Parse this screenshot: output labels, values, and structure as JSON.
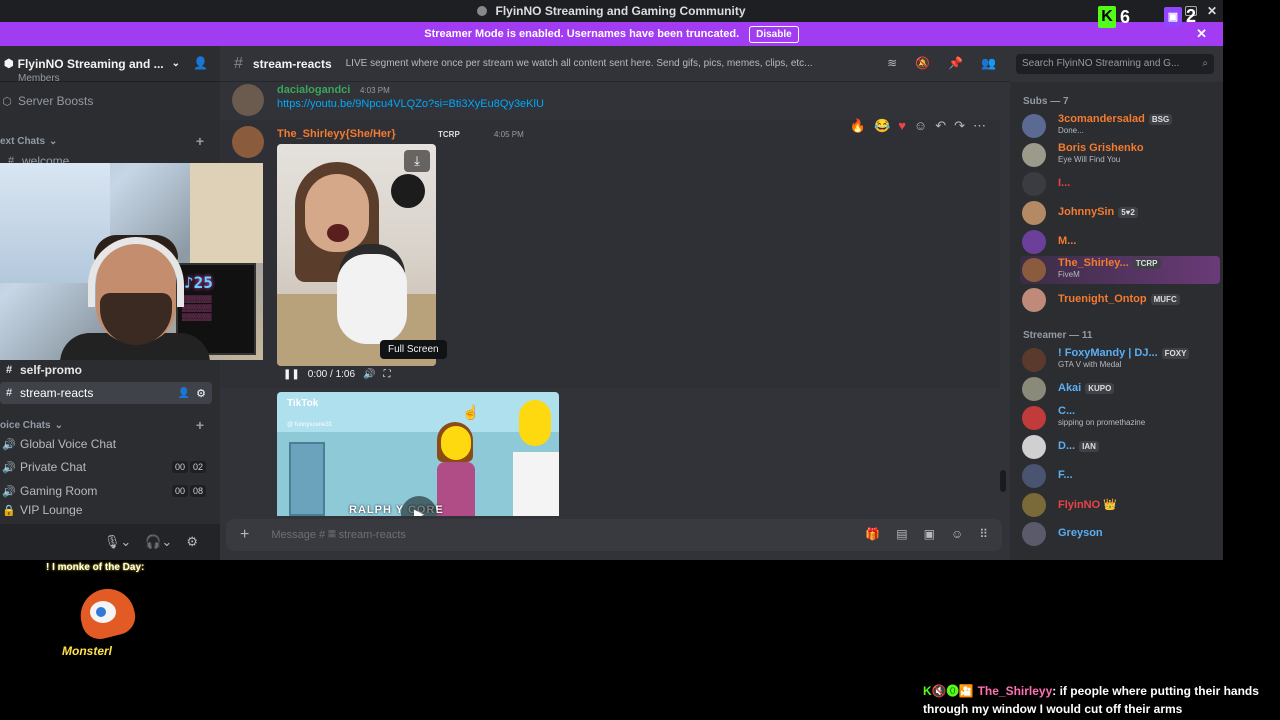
{
  "window": {
    "title": "FlyinNO Streaming and Gaming Community"
  },
  "banner": {
    "text": "Streamer Mode is enabled. Usernames have been truncated.",
    "button": "Disable",
    "close": "✕"
  },
  "overlay": {
    "kick_count": "6",
    "twitch_count": "2",
    "kick_icon": "K",
    "twitch_icon": "▣"
  },
  "server": {
    "name": "FlyinNO Streaming and ...",
    "members_label": "Members"
  },
  "sidebar": {
    "boosts": "Server Boosts",
    "text_cat": "ext Chats",
    "welcome": "welcome",
    "self_promo": "self-promo",
    "stream_reacts": "stream-reacts",
    "voice_cat": "oice Chats",
    "voice": [
      {
        "name": "Global Voice Chat"
      },
      {
        "name": "Private Chat",
        "a": "00",
        "b": "02"
      },
      {
        "name": "Gaming Room",
        "a": "00",
        "b": "08"
      },
      {
        "name": "VIP Lounge"
      }
    ]
  },
  "channel": {
    "name": "stream-reacts",
    "topic": "LIVE segment where once per stream we watch all content sent here. Send gifs, pics, memes, clips, etc..."
  },
  "search": {
    "placeholder": "Search FlyinNO Streaming and G..."
  },
  "messages": [
    {
      "author": "dacialogandci",
      "time": "4:03 PM",
      "link": "https://youtu.be/9Npcu4VLQZo?si=Bti3XyEu8Qy3eKlU"
    },
    {
      "author": "The_Shirleyy{She/Her}",
      "tag": "TCRP",
      "time": "4:05 PM"
    }
  ],
  "video1": {
    "time": "0:00 / 1:06",
    "tooltip": "Full Screen"
  },
  "video2": {
    "brand": "TikTok",
    "handle": "@ funnyscene31",
    "caption": "RALPH  Y CORE"
  },
  "composer": {
    "placeholder": "Message # 𝄜 stream-reacts"
  },
  "members": {
    "subs_header": "Subs — 7",
    "subs": [
      {
        "name": "3comandersalad",
        "tag": "BSG",
        "sub": "Done...",
        "color": "#f47b2f"
      },
      {
        "name": "Boris Grishenko",
        "sub": "Eye Will Find You",
        "color": "#f47b2f"
      },
      {
        "name": "I...",
        "color": "#ed4245"
      },
      {
        "name": "JohnnySin",
        "tag": "5♥2",
        "color": "#f47b2f"
      },
      {
        "name": "M...",
        "color": "#f47b2f"
      },
      {
        "name": "The_Shirley...",
        "tag": "TCRP",
        "sub": "FiveM",
        "color": "#f47b2f"
      },
      {
        "name": "Truenight_Ontop",
        "tag": "MUFC",
        "color": "#f47b2f"
      }
    ],
    "streamer_header": "Streamer — 11",
    "streamers": [
      {
        "name": "! FoxyMandy | DJ...",
        "tag": "FOXY",
        "sub": "GTA V with Medal",
        "color": "#5ab0f4"
      },
      {
        "name": "Akai",
        "tag": "KUPO",
        "color": "#5ab0f4"
      },
      {
        "name": "C...",
        "sub": "sipping on promethazine",
        "color": "#5ab0f4"
      },
      {
        "name": "D...",
        "tag": "IAN",
        "color": "#5ab0f4"
      },
      {
        "name": "F...",
        "color": "#5ab0f4"
      },
      {
        "name": "FlyinNO 👑",
        "color": "#ed4245"
      },
      {
        "name": "Greyson",
        "color": "#5ab0f4"
      }
    ]
  },
  "stream": {
    "monke_title": "! I monke of the Day:",
    "monke_name": "Monsterl",
    "chat_user": "The_Shirleyy",
    "chat_text": ": if people where putting their hands through my window I would cut off their arms",
    "chat_badges": "K🔇⓿🎦"
  }
}
